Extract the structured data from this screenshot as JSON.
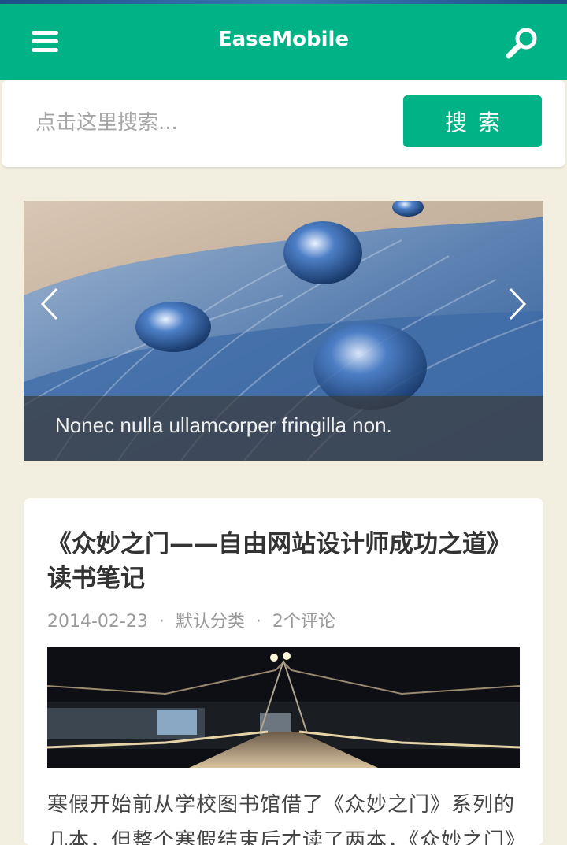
{
  "app": {
    "title": "EaseMobile",
    "brand_color": "#00b386",
    "background_color": "#f2eee0"
  },
  "header": {
    "menu_icon": "hamburger-menu-icon",
    "search_icon": "search-icon"
  },
  "search": {
    "placeholder": "点击这里搜索...",
    "value": "",
    "button_label": "搜索"
  },
  "slider": {
    "caption": "Nonec nulla ullamcorper fringilla non.",
    "prev_icon": "chevron-left-icon",
    "next_icon": "chevron-right-icon"
  },
  "post": {
    "title": "《众妙之门——自由网站设计师成功之道》读书笔记",
    "date": "2014-02-23",
    "category": "默认分类",
    "comments": "2个评论",
    "meta_separator": "·",
    "excerpt": "寒假开始前从学校图书馆借了《众妙之门》系列的几本，但整个寒假结束后才读了两本，《众妙之门》"
  }
}
